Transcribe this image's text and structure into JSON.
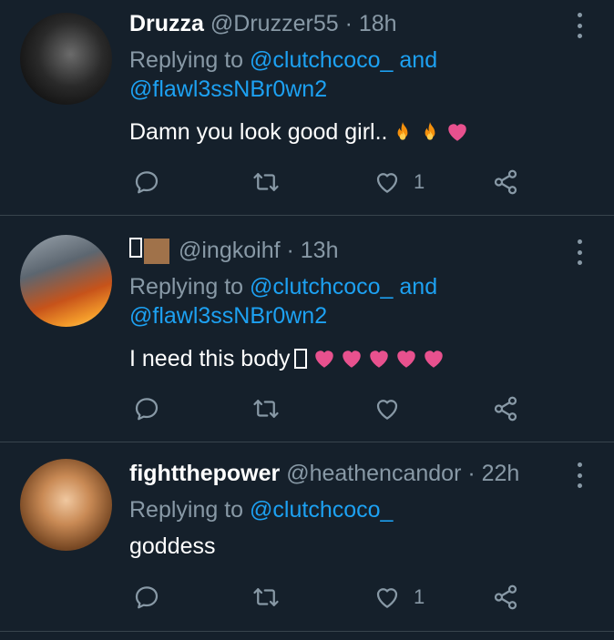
{
  "tweets": [
    {
      "display_name": "Druzza",
      "meta": "@Druzzer55 · 18h",
      "reply_prefix": "Replying to ",
      "reply_user1": "@clutchcoco_",
      "reply_and": " and",
      "reply_user2": "@flawl3ssNBr0wn2",
      "text": "Damn you look good girl..",
      "like_count": "1"
    },
    {
      "display_name": "",
      "meta": "@ingkoihf · 13h",
      "reply_prefix": "Replying to ",
      "reply_user1": "@clutchcoco_",
      "reply_and": " and",
      "reply_user2": "@flawl3ssNBr0wn2",
      "text": "I need this body",
      "like_count": ""
    },
    {
      "display_name": "fightthepower",
      "meta": "@heathencandor · 22h",
      "reply_prefix": "Replying to ",
      "reply_user1": "@clutchcoco_",
      "text": "goddess",
      "like_count": "1"
    }
  ],
  "icons": [
    "reply-icon",
    "retweet-icon",
    "like-icon",
    "share-icon",
    "more-icon",
    "fire-emoji",
    "heart-emoji"
  ],
  "colors": {
    "background": "#15202b",
    "divider": "#38444d",
    "muted": "#8899a6",
    "link": "#1da1f2",
    "heart_emoji": "#e8518e",
    "fire_emoji": "#f4900c"
  }
}
